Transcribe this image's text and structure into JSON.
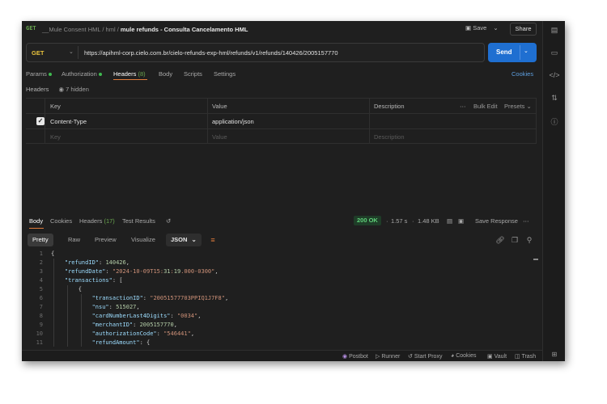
{
  "titlebar": {
    "req_badge": "GET",
    "breadcrumb_1": "__Mule Consent HML",
    "breadcrumb_2": "hml",
    "breadcrumb_current": "mule refunds - Consulta Cancelamento HML",
    "save_label": "Save",
    "share_label": "Share"
  },
  "request": {
    "method": "GET",
    "url": "https://apihml-corp.cielo.com.br/cielo-refunds-exp-hml/refunds/v1/refunds/140426/2005157770",
    "send_label": "Send"
  },
  "req_tabs": {
    "params": "Params",
    "authorization": "Authorization",
    "headers": "Headers",
    "headers_count": "(8)",
    "body": "Body",
    "scripts": "Scripts",
    "settings": "Settings",
    "cookies": "Cookies"
  },
  "headers_section": {
    "title": "Headers",
    "hidden": "7 hidden",
    "col_key": "Key",
    "col_value": "Value",
    "col_description": "Description",
    "bulk_edit": "Bulk Edit",
    "presets": "Presets",
    "rows": [
      {
        "key": "Content-Type",
        "value": "application/json",
        "checked": true
      }
    ],
    "placeholder_key": "Key",
    "placeholder_value": "Value",
    "placeholder_description": "Description"
  },
  "response": {
    "tabs": {
      "body": "Body",
      "cookies": "Cookies",
      "headers": "Headers",
      "headers_count": "(17)",
      "test_results": "Test Results"
    },
    "status": "200 OK",
    "time": "1.57 s",
    "size": "1.48 KB",
    "save_response": "Save Response",
    "views": {
      "pretty": "Pretty",
      "raw": "Raw",
      "preview": "Preview",
      "visualize": "Visualize",
      "format": "JSON"
    }
  },
  "code_lines": [
    {
      "n": "1",
      "t": "{"
    },
    {
      "n": "2",
      "t": "    \"refundID\": 140426,"
    },
    {
      "n": "3",
      "t": "    \"refundDate\": \"2024-10-09T15:31:19.000-0300\","
    },
    {
      "n": "4",
      "t": "    \"transactions\": ["
    },
    {
      "n": "5",
      "t": "        {"
    },
    {
      "n": "6",
      "t": "            \"transactionID\": \"20051577703PPIQ1J7F8\","
    },
    {
      "n": "7",
      "t": "            \"nsu\": 515027,"
    },
    {
      "n": "8",
      "t": "            \"cardNumberLast4Digits\": \"0034\","
    },
    {
      "n": "9",
      "t": "            \"merchantID\": 2005157770,"
    },
    {
      "n": "10",
      "t": "            \"authorizationCode\": \"546441\","
    },
    {
      "n": "11",
      "t": "            \"refundAmount\": {"
    }
  ],
  "statusbar": {
    "postbot": "Postbot",
    "runner": "Runner",
    "start_proxy": "Start Proxy",
    "cookies": "Cookies",
    "vault": "Vault",
    "trash": "Trash"
  },
  "colors": {
    "accent": "#e07b3c",
    "send": "#1f6fd1",
    "status_ok": "#5fd17a",
    "method_get": "#e8c33d"
  }
}
